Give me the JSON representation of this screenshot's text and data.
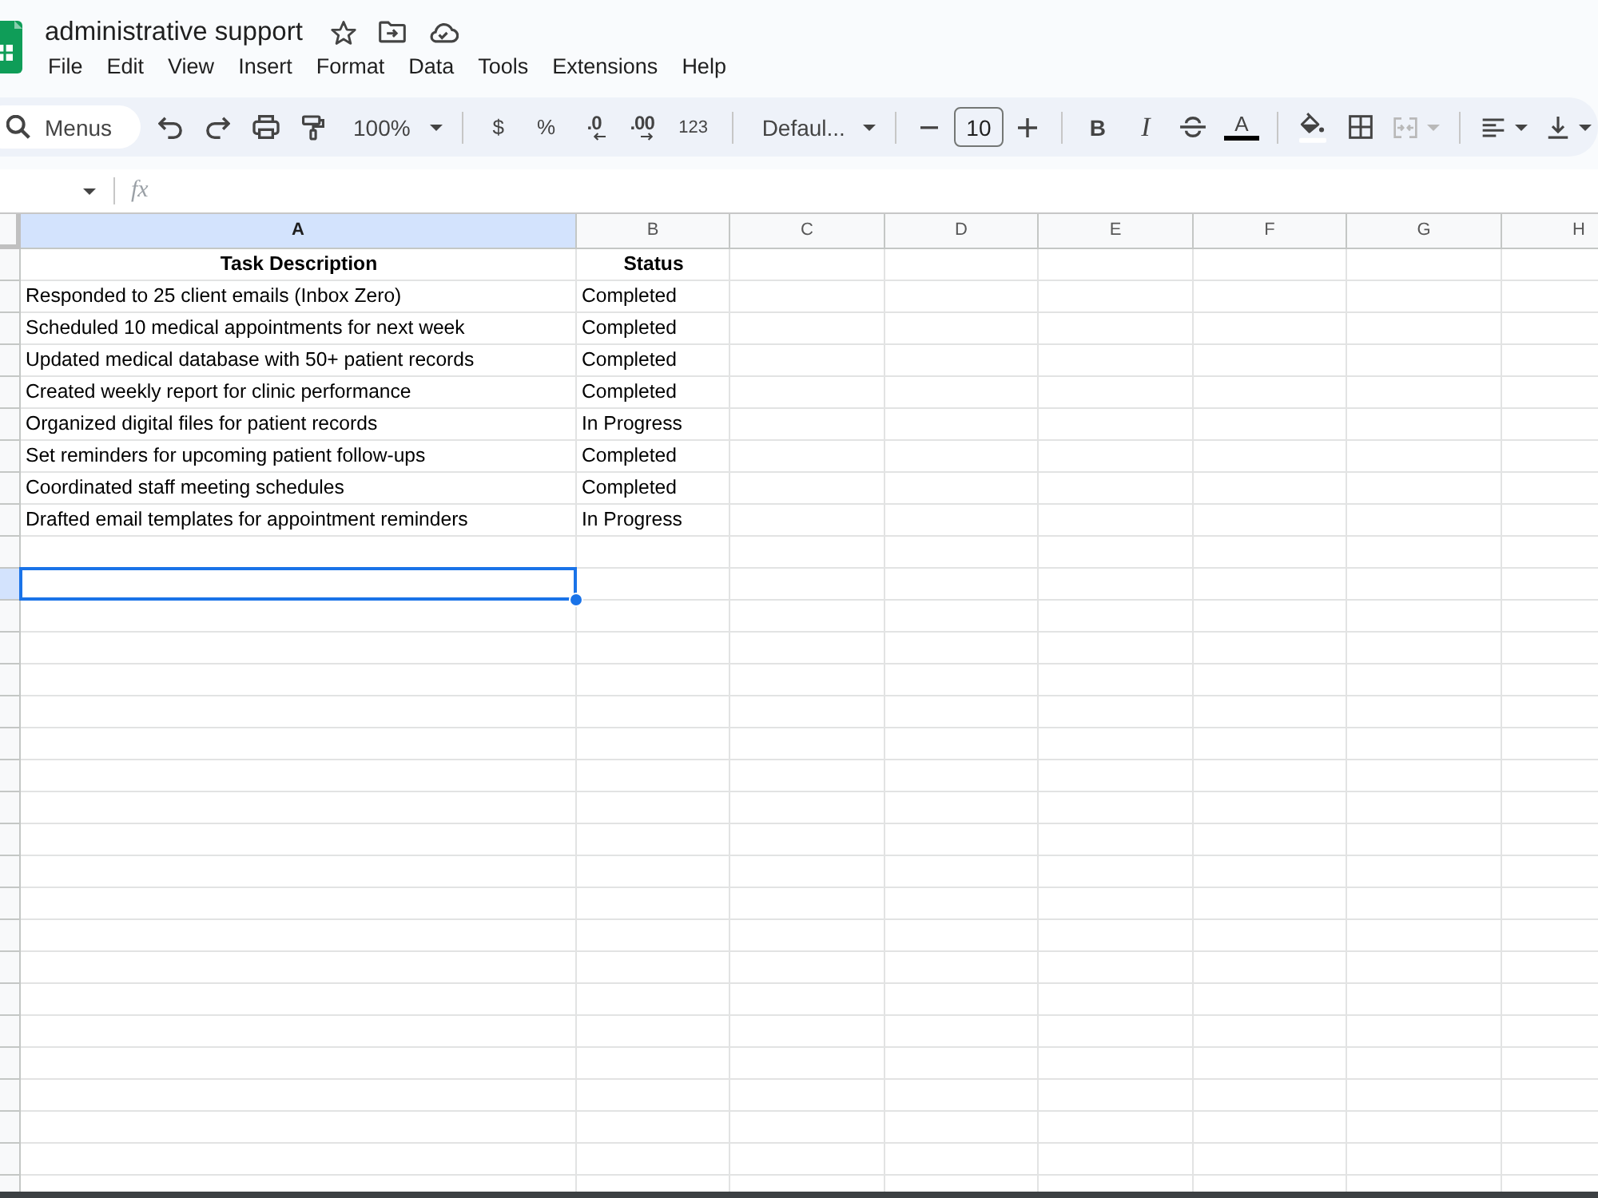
{
  "document": {
    "title": "administrative support"
  },
  "menu": [
    "File",
    "Edit",
    "View",
    "Insert",
    "Format",
    "Data",
    "Tools",
    "Extensions",
    "Help"
  ],
  "toolbar": {
    "search": {
      "placeholder": "Menus"
    },
    "zoom": "100%",
    "currency": "$",
    "percent": "%",
    "decrease_decimal": ".0",
    "increase_decimal": ".00",
    "number_format": "123",
    "font": "Defaul...",
    "font_size": "10",
    "bold": "B",
    "italic": "I",
    "text_color": "A",
    "merge": {
      "disabled": true
    }
  },
  "formula_bar": {
    "label": "fx"
  },
  "sheet": {
    "columns": [
      {
        "label": "A",
        "selected": true
      },
      {
        "label": "B",
        "selected": false
      },
      {
        "label": "C",
        "selected": false
      },
      {
        "label": "D",
        "selected": false
      },
      {
        "label": "E",
        "selected": false
      },
      {
        "label": "F",
        "selected": false
      },
      {
        "label": "G",
        "selected": false
      },
      {
        "label": "H",
        "selected": false
      }
    ],
    "rows": [
      {
        "kind": "header",
        "selected": false,
        "cells": [
          "Task Description",
          "Status"
        ]
      },
      {
        "kind": "data",
        "selected": false,
        "cells": [
          "Responded to 25 client emails (Inbox Zero)",
          "Completed"
        ]
      },
      {
        "kind": "data",
        "selected": false,
        "cells": [
          "Scheduled 10 medical appointments for next week",
          "Completed"
        ]
      },
      {
        "kind": "data",
        "selected": false,
        "cells": [
          "Updated medical database with 50+ patient records",
          "Completed"
        ]
      },
      {
        "kind": "data",
        "selected": false,
        "cells": [
          "Created weekly report for clinic performance",
          "Completed"
        ]
      },
      {
        "kind": "data",
        "selected": false,
        "cells": [
          "Organized digital files for patient records",
          "In Progress"
        ]
      },
      {
        "kind": "data",
        "selected": false,
        "cells": [
          "Set reminders for upcoming patient follow-ups",
          "Completed"
        ]
      },
      {
        "kind": "data",
        "selected": false,
        "cells": [
          "Coordinated staff meeting schedules",
          "Completed"
        ]
      },
      {
        "kind": "data",
        "selected": false,
        "cells": [
          "Drafted email templates for appointment reminders",
          "In Progress"
        ]
      },
      {
        "kind": "empty",
        "selected": false
      },
      {
        "kind": "empty",
        "selected": true
      },
      {
        "kind": "empty",
        "selected": false
      },
      {
        "kind": "empty",
        "selected": false
      },
      {
        "kind": "empty",
        "selected": false
      },
      {
        "kind": "empty",
        "selected": false
      },
      {
        "kind": "empty",
        "selected": false
      },
      {
        "kind": "empty",
        "selected": false
      },
      {
        "kind": "empty",
        "selected": false
      },
      {
        "kind": "empty",
        "selected": false
      },
      {
        "kind": "empty",
        "selected": false
      },
      {
        "kind": "empty",
        "selected": false
      },
      {
        "kind": "empty",
        "selected": false
      },
      {
        "kind": "empty",
        "selected": false
      },
      {
        "kind": "empty",
        "selected": false
      },
      {
        "kind": "empty",
        "selected": false
      },
      {
        "kind": "empty",
        "selected": false
      },
      {
        "kind": "empty",
        "selected": false
      },
      {
        "kind": "empty",
        "selected": false
      },
      {
        "kind": "empty",
        "selected": false
      },
      {
        "kind": "empty",
        "selected": false
      }
    ]
  }
}
